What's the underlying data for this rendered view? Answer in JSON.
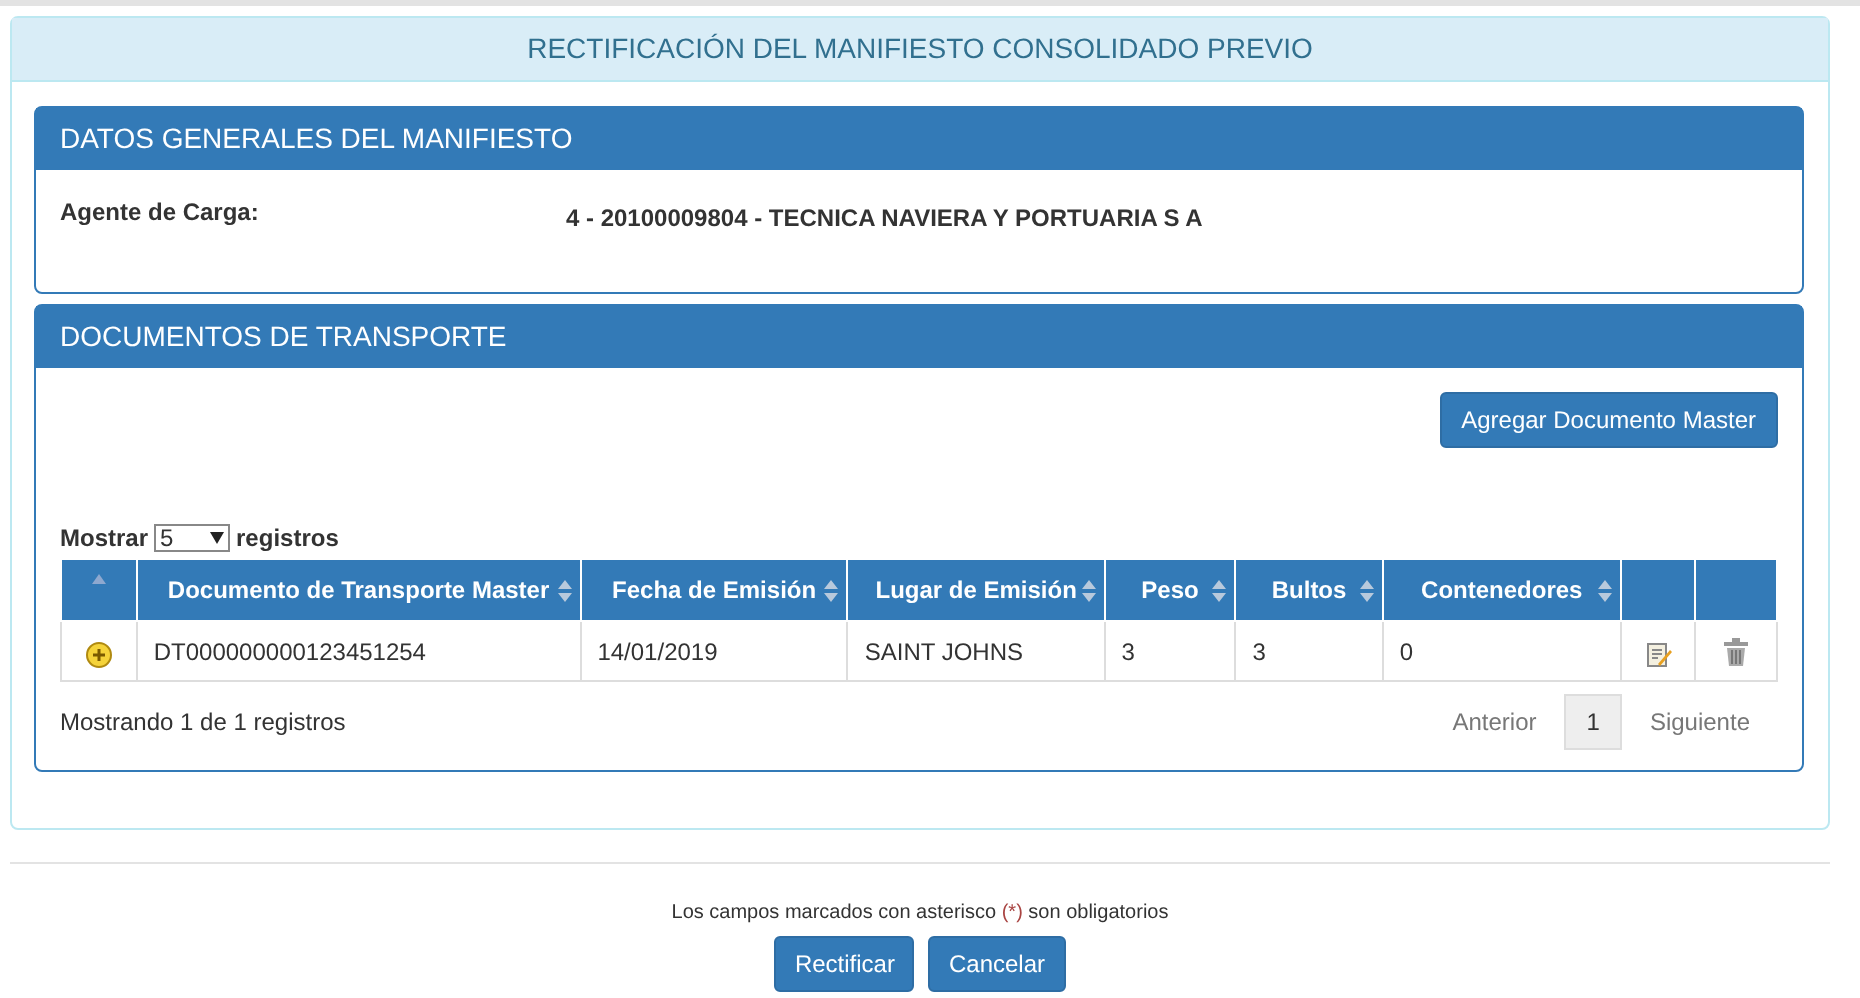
{
  "page_title": "RECTIFICACIÓN DEL MANIFIESTO CONSOLIDADO PREVIO",
  "general_panel": {
    "title": "DATOS GENERALES DEL MANIFIESTO",
    "label": "Agente de Carga:",
    "value": "4 - 20100009804 - TECNICA NAVIERA Y PORTUARIA S A"
  },
  "transport_panel": {
    "title": "DOCUMENTOS DE TRANSPORTE",
    "add_button": "Agregar Documento Master",
    "length": {
      "before": "Mostrar",
      "value": "5",
      "after": "registros"
    },
    "table": {
      "expand_column_sorted": true,
      "columns": [
        {
          "label": "Documento de Transporte Master",
          "sortable": true
        },
        {
          "label": "Fecha de Emisión",
          "sortable": true
        },
        {
          "label": "Lugar de Emisión",
          "sortable": true
        },
        {
          "label": "Peso",
          "sortable": true
        },
        {
          "label": "Bultos",
          "sortable": true
        },
        {
          "label": "Contenedores",
          "sortable": true
        }
      ],
      "rows": [
        {
          "cells": [
            "DT000000000123451254",
            "14/01/2019",
            "SAINT JOHNS",
            "3",
            "3",
            "0"
          ]
        }
      ]
    },
    "info": "Mostrando 1 de 1 registros",
    "pagination": {
      "previous": "Anterior",
      "pages": [
        {
          "label": "1",
          "selected": true
        }
      ],
      "next": "Siguiente"
    }
  },
  "note": {
    "before": "Los campos marcados con asterisco",
    "mark": "(*)",
    "after": "son obligatorios"
  },
  "buttons": [
    "Rectificar",
    "Cancelar"
  ]
}
